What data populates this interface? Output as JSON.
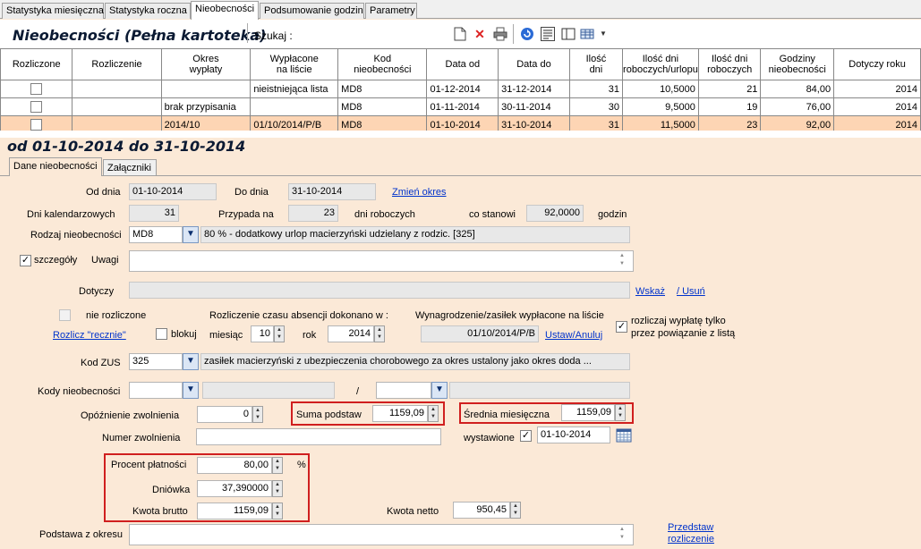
{
  "top_tabs": [
    "Statystyka miesięczna",
    "Statystyka roczna",
    "Nieobecności",
    "Podsumowanie godzin",
    "Parametry"
  ],
  "toolbar": {
    "title": "Nieobecności (Pełna kartoteka)",
    "search_label": "Szukaj :"
  },
  "grid": {
    "headers": [
      "Rozliczone",
      "Rozliczenie",
      "Okres\nwypłaty",
      "Wypłacone\nna liście",
      "Kod\nnieobecności",
      "Data od",
      "Data do",
      "Ilość\ndni",
      "Ilość dni\nroboczych/urlopu",
      "Ilość dni\nroboczych",
      "Godziny\nnieobecności",
      "Dotyczy roku"
    ],
    "rows": [
      {
        "rozliczenie": "",
        "okres": "",
        "wyplacone": "nieistniejąca lista",
        "kod": "MD8",
        "od": "01-12-2014",
        "do": "31-12-2014",
        "dni": "31",
        "rob_url": "10,5000",
        "rob": "21",
        "godz": "84,00",
        "rok": "2014"
      },
      {
        "rozliczenie": "",
        "okres": "brak przypisania",
        "wyplacone": "",
        "kod": "MD8",
        "od": "01-11-2014",
        "do": "30-11-2014",
        "dni": "30",
        "rob_url": "9,5000",
        "rob": "19",
        "godz": "76,00",
        "rok": "2014"
      },
      {
        "rozliczenie": "",
        "okres": "2014/10",
        "wyplacone": "01/10/2014/P/B",
        "kod": "MD8",
        "od": "01-10-2014",
        "do": "31-10-2014",
        "dni": "31",
        "rob_url": "11,5000",
        "rob": "23",
        "godz": "92,00",
        "rok": "2014"
      }
    ]
  },
  "range_title": "od 01-10-2014 do 31-10-2014",
  "sub_tabs": [
    "Dane nieobecności",
    "Załączniki"
  ],
  "form": {
    "od_dnia_label": "Od dnia",
    "od_dnia": "01-10-2014",
    "do_dnia_label": "Do dnia",
    "do_dnia": "31-10-2014",
    "zmien_okres": "Zmień okres",
    "dni_kal_label": "Dni kalendarzowych",
    "dni_kal": "31",
    "przypada_label": "Przypada na",
    "przypada": "23",
    "dni_rob_label": "dni roboczych",
    "co_stanowi_label": "co stanowi",
    "co_stanowi": "92,0000",
    "godzin_label": "godzin",
    "rodzaj_label": "Rodzaj nieobecności",
    "rodzaj_code": "MD8",
    "rodzaj_desc": "80 % - dodatkowy urlop macierzyński udzielany z rodzic. [325]",
    "szczegoly_label": "szczegóły",
    "uwagi_label": "Uwagi",
    "dotyczy_label": "Dotyczy",
    "wskaz": "Wskaż",
    "usun": "/ Usuń",
    "nie_rozliczone_label": "nie rozliczone",
    "rozlicz_recznie": "Rozlicz \"recznie\"",
    "blokuj_label": "blokuj",
    "rozliczenie_czasu_label": "Rozliczenie czasu absencji dokonano w :",
    "miesiac_label": "miesiąc",
    "miesiac": "10",
    "rok_label": "rok",
    "rok": "2014",
    "wynagrodzenie_label": "Wynagrodzenie/zasiłek wypłacone na liście",
    "wynagrodzenie": "01/10/2014/P/B",
    "ustaw_anuluj": "Ustaw/Anuluj",
    "rozliczaj_label_1": "rozliczaj wypłatę tylko",
    "rozliczaj_label_2": "przez powiązanie z listą",
    "kod_zus_label": "Kod ZUS",
    "kod_zus": "325",
    "kod_zus_desc": "zasiłek macierzyński z ubezpieczenia chorobowego za okres ustalony jako okres doda ...",
    "kody_nieob_label": "Kody nieobecności",
    "slash": "/",
    "opoznienie_label": "Opóźnienie zwolnienia",
    "opoznienie": "0",
    "suma_podstaw_label": "Suma podstaw",
    "suma_podstaw": "1159,09",
    "srednia_label": "Średnia miesięczna",
    "srednia": "1159,09",
    "numer_zwolnienia_label": "Numer zwolnienia",
    "wystawione_label": "wystawione",
    "wystawione": "01-10-2014",
    "procent_label": "Procent płatności",
    "procent": "80,00",
    "procent_unit": "%",
    "dniowka_label": "Dniówka",
    "dniowka": "37,390000",
    "kwota_brutto_label": "Kwota brutto",
    "kwota_brutto": "1159,09",
    "kwota_netto_label": "Kwota netto",
    "kwota_netto": "950,45",
    "podstawa_label": "Podstawa z okresu",
    "przedstaw_1": "Przedstaw",
    "przedstaw_2": "rozliczenie"
  }
}
